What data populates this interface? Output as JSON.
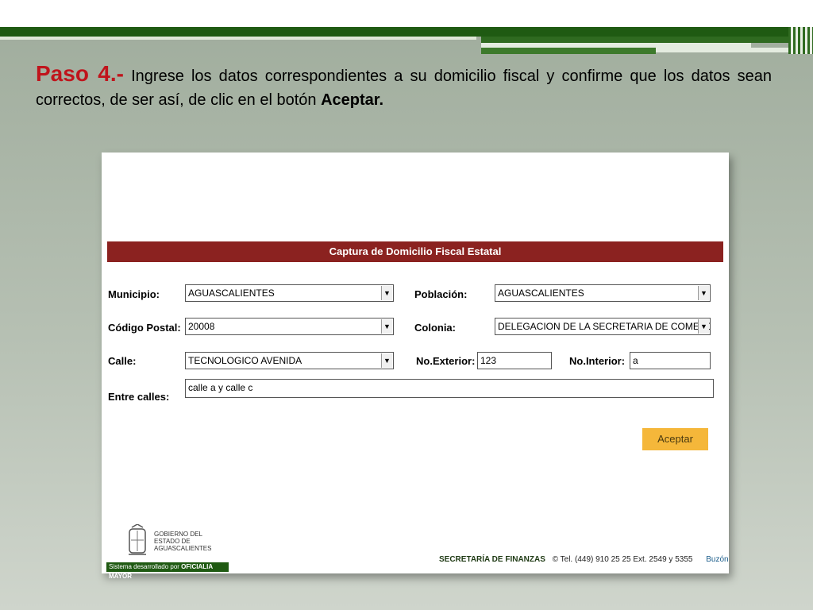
{
  "slide": {
    "step_label": "Paso 4.-",
    "text_intro": "Ingrese los datos correspondientes a su domicilio fiscal y confirme que los datos sean correctos, de ser así, de clic en el botón",
    "text_bold": "Aceptar."
  },
  "form": {
    "title": "Captura de Domicilio Fiscal Estatal",
    "municipio": {
      "label": "Municipio:",
      "value": "AGUASCALIENTES"
    },
    "poblacion": {
      "label": "Población:",
      "value": "AGUASCALIENTES"
    },
    "codigo_postal": {
      "label": "Código Postal:",
      "value": "20008"
    },
    "colonia": {
      "label": "Colonia:",
      "value": "DELEGACION DE LA SECRETARIA DE COMERCIO Y"
    },
    "calle": {
      "label": "Calle:",
      "value": "TECNOLOGICO AVENIDA"
    },
    "no_exterior": {
      "label": "No.Exterior:",
      "value": "123"
    },
    "no_interior": {
      "label": "No.Interior:",
      "value": "a"
    },
    "entre_calles": {
      "label": "Entre calles:",
      "value": "calle a y calle c"
    },
    "accept_button": "Aceptar"
  },
  "footer": {
    "gov_line1": "GOBIERNO DEL",
    "gov_line2": "ESTADO DE",
    "gov_line3": "AGUASCALIENTES",
    "system_prefix": "Sistema desarrollado por",
    "system_bold": "OFICIALIA MAYOR",
    "secretaria": "SECRETARÍA DE FINANZAS",
    "contact": "© Tel. (449) 910 25 25  Ext. 2549 y 5355",
    "buzon": "Buzón"
  },
  "colors": {
    "header_bar": "#8b2220",
    "accent_green": "#1f5a12",
    "button": "#f5b73a",
    "step_red": "#c0141c"
  }
}
